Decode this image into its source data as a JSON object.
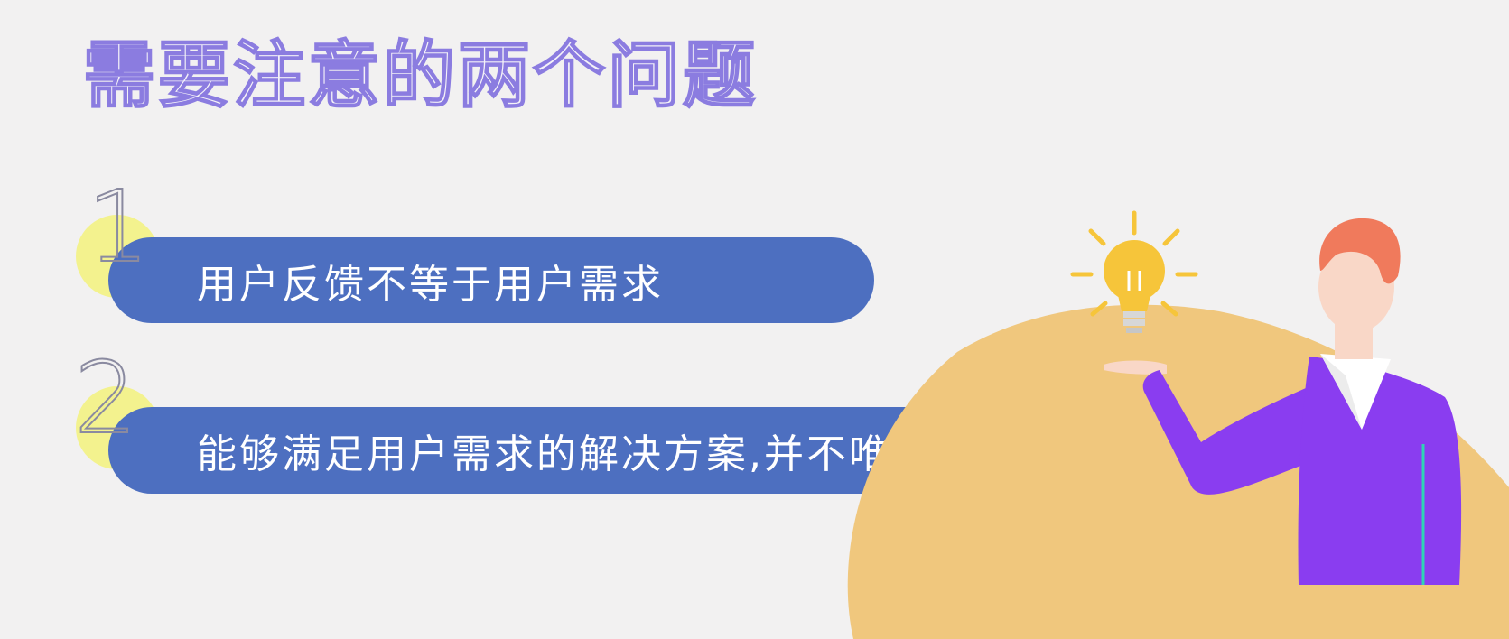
{
  "title": "需要注意的两个问题",
  "items": [
    {
      "number": "1",
      "text": "用户反馈不等于用户需求"
    },
    {
      "number": "2",
      "text": "能够满足用户需求的解决方案,并不唯一"
    }
  ],
  "colors": {
    "background": "#f2f1f1",
    "pill": "#4d6fc0",
    "badge": "#f3f28e",
    "title_outline": "#8b7ce0",
    "hill": "#f0c77d",
    "shirt": "#8a3df0",
    "hair": "#f07a5c",
    "bulb": "#f6c53a"
  },
  "illustration": {
    "subject": "person-holding-lightbulb-icon"
  }
}
